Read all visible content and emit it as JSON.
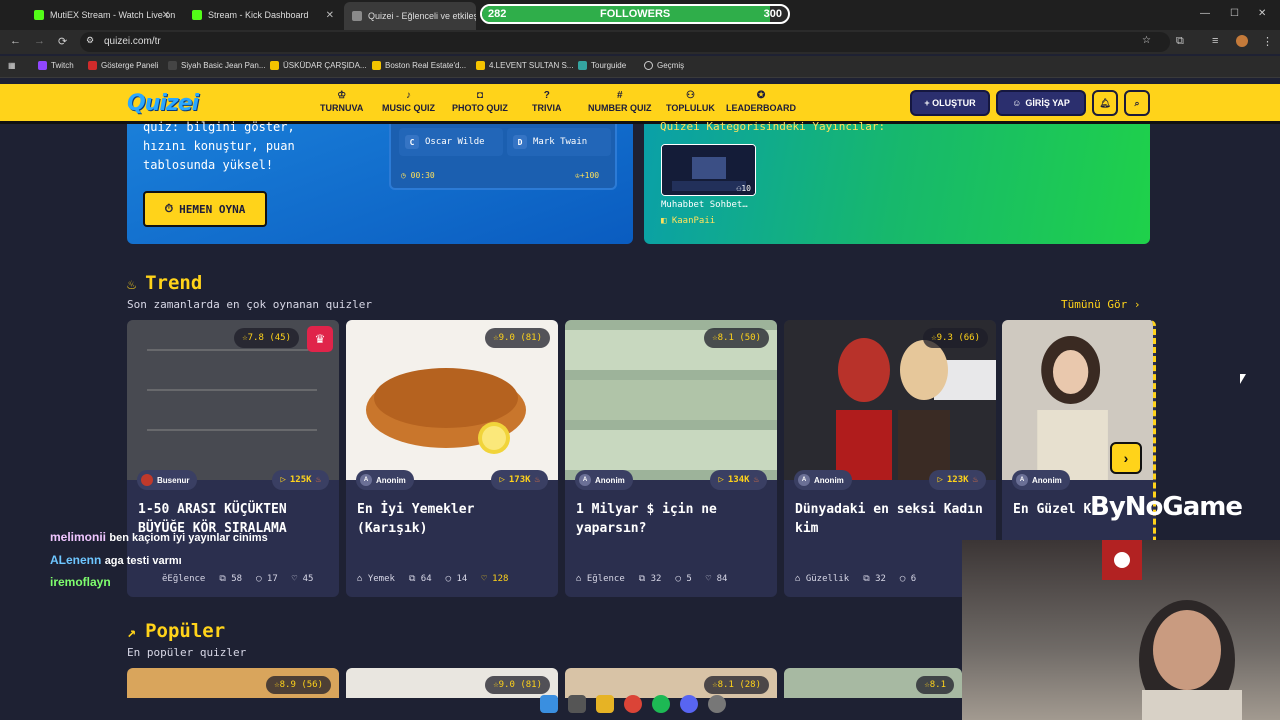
{
  "browser": {
    "tabs": [
      {
        "title": "MutiEX Stream - Watch Live on",
        "color": "#53fc18"
      },
      {
        "title": "Stream - Kick Dashboard",
        "color": "#53fc18"
      },
      {
        "title": "Quizei - Eğlenceli ve etkileşimli",
        "color": "#8a8a8a"
      }
    ],
    "url": "quizei.com/tr",
    "bookmarks": [
      "Twitch",
      "Gösterge Paneli",
      "Siyah Basic Jean Pan...",
      "ÜSKÜDAR ÇARŞIDA...",
      "Boston Real Estate'd...",
      "4.LEVENT SULTAN S...",
      "Tourguide",
      "Geçmiş"
    ]
  },
  "followers_goal": {
    "current": "282",
    "label": "FOLLOWERS",
    "target": "300",
    "progress": 0.94
  },
  "site": {
    "logo": "Quizei",
    "nav": [
      {
        "label": "TURNUVA",
        "icon": "trophy-icon"
      },
      {
        "label": "MUSIC QUIZ",
        "icon": "music-icon"
      },
      {
        "label": "PHOTO QUIZ",
        "icon": "camera-icon"
      },
      {
        "label": "TRIVIA",
        "icon": "question-icon"
      },
      {
        "label": "NUMBER QUIZ",
        "icon": "hash-icon"
      },
      {
        "label": "TOPLULUK",
        "icon": "users-icon"
      },
      {
        "label": "LEADERBOARD",
        "icon": "medal-icon"
      }
    ],
    "create_label": "+ OLUŞTUR",
    "login_label": "GİRİŞ YAP"
  },
  "hero": {
    "text": "quiz: bilgini göster, hızını konuştur, puan tablosunda yüksel!",
    "cta": "HEMEN OYNA",
    "quiz_options": [
      {
        "letter": "C",
        "text": "Oscar Wilde"
      },
      {
        "letter": "D",
        "text": "Mark Twain"
      }
    ],
    "quiz_timer": "00:30",
    "quiz_points": "+100",
    "streamers_title": "Quizei Kategorisindeki Yayıncılar:",
    "stream": {
      "title": "Muhabbet Sohbet…",
      "user": "KaanPaii",
      "viewers": "10"
    }
  },
  "trend": {
    "title": "Trend",
    "subtitle": "Son zamanlarda en çok oynanan quizler",
    "see_all": "Tümünü Gör ›",
    "cards": [
      {
        "rating": "7.8 (45)",
        "author": "Busenur",
        "plays": "125K",
        "title": "1-50 ARASI KÜÇÜKTEN BÜYÜĞE KÖR SIRALAMA",
        "category": "Eğlence",
        "questions": "58",
        "comments": "17",
        "likes": "45"
      },
      {
        "rating": "9.0 (81)",
        "author": "Anonim",
        "plays": "173K",
        "title": "En İyi Yemekler (Karışık)",
        "category": "Yemek",
        "questions": "64",
        "comments": "14",
        "likes": "128"
      },
      {
        "rating": "8.1 (50)",
        "author": "Anonim",
        "plays": "134K",
        "title": "1 Milyar $ için ne yaparsın?",
        "category": "Eğlence",
        "questions": "32",
        "comments": "5",
        "likes": "84"
      },
      {
        "rating": "9.3 (66)",
        "author": "Anonim",
        "plays": "123K",
        "title": "Dünyadaki en seksi Kadın kim",
        "category": "Güzellik",
        "questions": "32",
        "comments": "6",
        "likes": ""
      },
      {
        "rating": "",
        "author": "Anonim",
        "plays": "",
        "title": "En Güzel K",
        "category": "",
        "questions": "",
        "comments": "",
        "likes": ""
      }
    ]
  },
  "popular": {
    "title": "Popüler",
    "subtitle": "En popüler quizler",
    "ratings": [
      "8.9 (56)",
      "9.0 (81)",
      "8.1 (28)",
      "8.1"
    ]
  },
  "chat": [
    {
      "user": "melimonii",
      "message": "ben kaçiom iyi yayınlar cinims",
      "color": "#f0c6ff"
    },
    {
      "user": "ALenenn",
      "message": "aga testi varmı",
      "color": "#6ec6ff"
    },
    {
      "user": "iremoflayn",
      "message": "",
      "color": "#7fff6e"
    }
  ],
  "watermark": "ByNoGame"
}
